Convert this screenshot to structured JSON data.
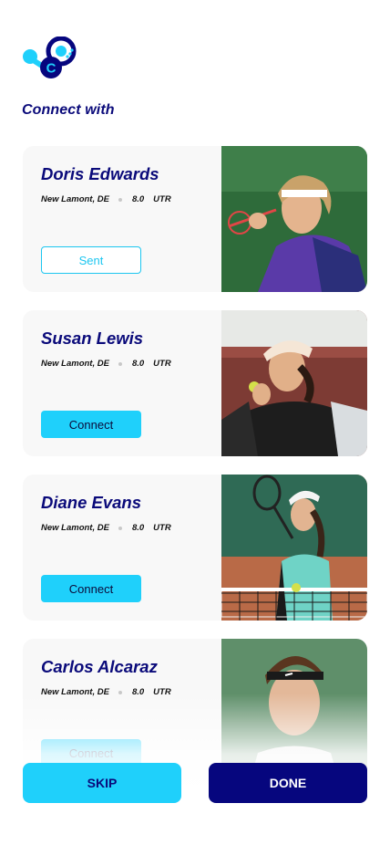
{
  "header": {
    "section_title": "Connect with"
  },
  "players": [
    {
      "name": "Doris Edwards",
      "location": "New Lamont, DE",
      "rating": "8.0",
      "rating_unit": "UTR",
      "action_label": "Sent",
      "action_state": "sent"
    },
    {
      "name": "Susan Lewis",
      "location": "New Lamont, DE",
      "rating": "8.0",
      "rating_unit": "UTR",
      "action_label": "Connect",
      "action_state": "connect"
    },
    {
      "name": "Diane Evans",
      "location": "New Lamont, DE",
      "rating": "8.0",
      "rating_unit": "UTR",
      "action_label": "Connect",
      "action_state": "connect"
    },
    {
      "name": "Carlos Alcaraz",
      "location": "New Lamont, DE",
      "rating": "8.0",
      "rating_unit": "UTR",
      "action_label": "Connect",
      "action_state": "connect"
    }
  ],
  "footer": {
    "skip_label": "SKIP",
    "done_label": "DONE"
  },
  "colors": {
    "primary_navy": "#0a0a7a",
    "accent_cyan": "#1fd0fb",
    "card_bg": "#f8f8f8"
  }
}
